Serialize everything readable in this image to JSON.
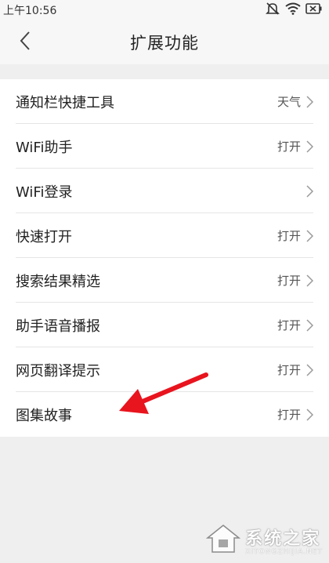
{
  "status_bar": {
    "time": "上午10:56",
    "icons": [
      "mute-icon",
      "wifi-icon",
      "battery-icon"
    ]
  },
  "header": {
    "title": "扩展功能",
    "back_icon": "chevron-left-icon"
  },
  "items": [
    {
      "label": "通知栏快捷工具",
      "value": "天气"
    },
    {
      "label": "WiFi助手",
      "value": "打开"
    },
    {
      "label": "WiFi登录",
      "value": ""
    },
    {
      "label": "快速打开",
      "value": "打开"
    },
    {
      "label": "搜索结果精选",
      "value": "打开"
    },
    {
      "label": "助手语音播报",
      "value": "打开"
    },
    {
      "label": "网页翻译提示",
      "value": "打开"
    },
    {
      "label": "图集故事",
      "value": "打开"
    }
  ],
  "annotation": {
    "color": "#e8141e"
  },
  "watermark": {
    "name": "系统之家",
    "domain": "XITONGZHIJIA.NET"
  },
  "colors": {
    "background": "#efefef",
    "bar": "#f7f7f7",
    "list": "#ffffff",
    "divider": "#e5e5e5"
  }
}
